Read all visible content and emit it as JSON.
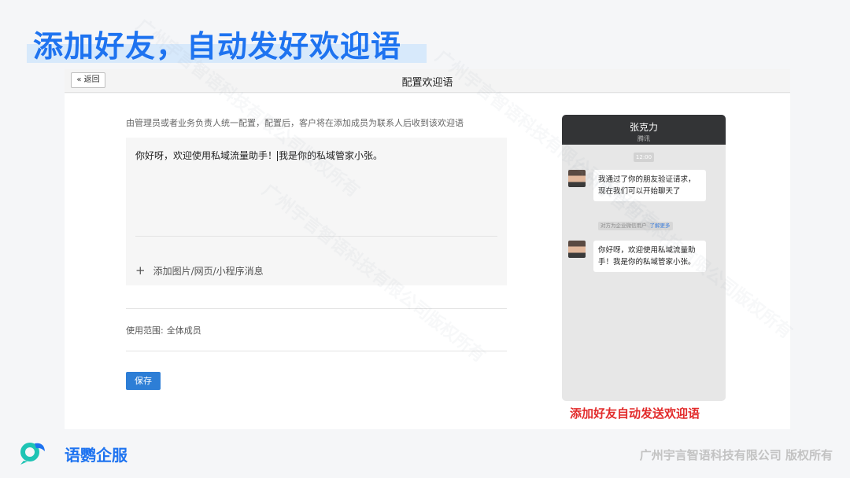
{
  "slide": {
    "headline": "添加好友，自动发好欢迎语",
    "preview_caption": "添加好友自动发送欢迎语",
    "brand": "语鹦企服",
    "copyright": "广州宇言智语科技有限公司 版权所有",
    "watermark": "广州宇言智语科技有限公司版权所有",
    "accent_color": "#1e73f0",
    "caption_color": "#e22b2b"
  },
  "topbar": {
    "back_label": "« 返回",
    "title": "配置欢迎语"
  },
  "form": {
    "description": "由管理员或者业务负责人统一配置，配置后，客户将在添加成员为联系人后收到该欢迎语",
    "message_before_caret": "你好呀，欢迎使用私域流量助手！",
    "message_after_caret": "我是你的私域管家小张。",
    "add_media_label": "添加图片/网页/小程序消息",
    "scope_label": "使用范围:",
    "scope_value": "全体成员",
    "save_label": "保存"
  },
  "preview": {
    "contact_name": "张克力",
    "contact_org": "腾讯",
    "time": "12:00",
    "message1": "我通过了你的朋友验证请求，现在我们可以开始聊天了",
    "notice": "对方为企业微信用户",
    "notice_link": "了解更多",
    "message2": "你好呀，欢迎使用私域流量助手！我是你的私域管家小张。"
  }
}
